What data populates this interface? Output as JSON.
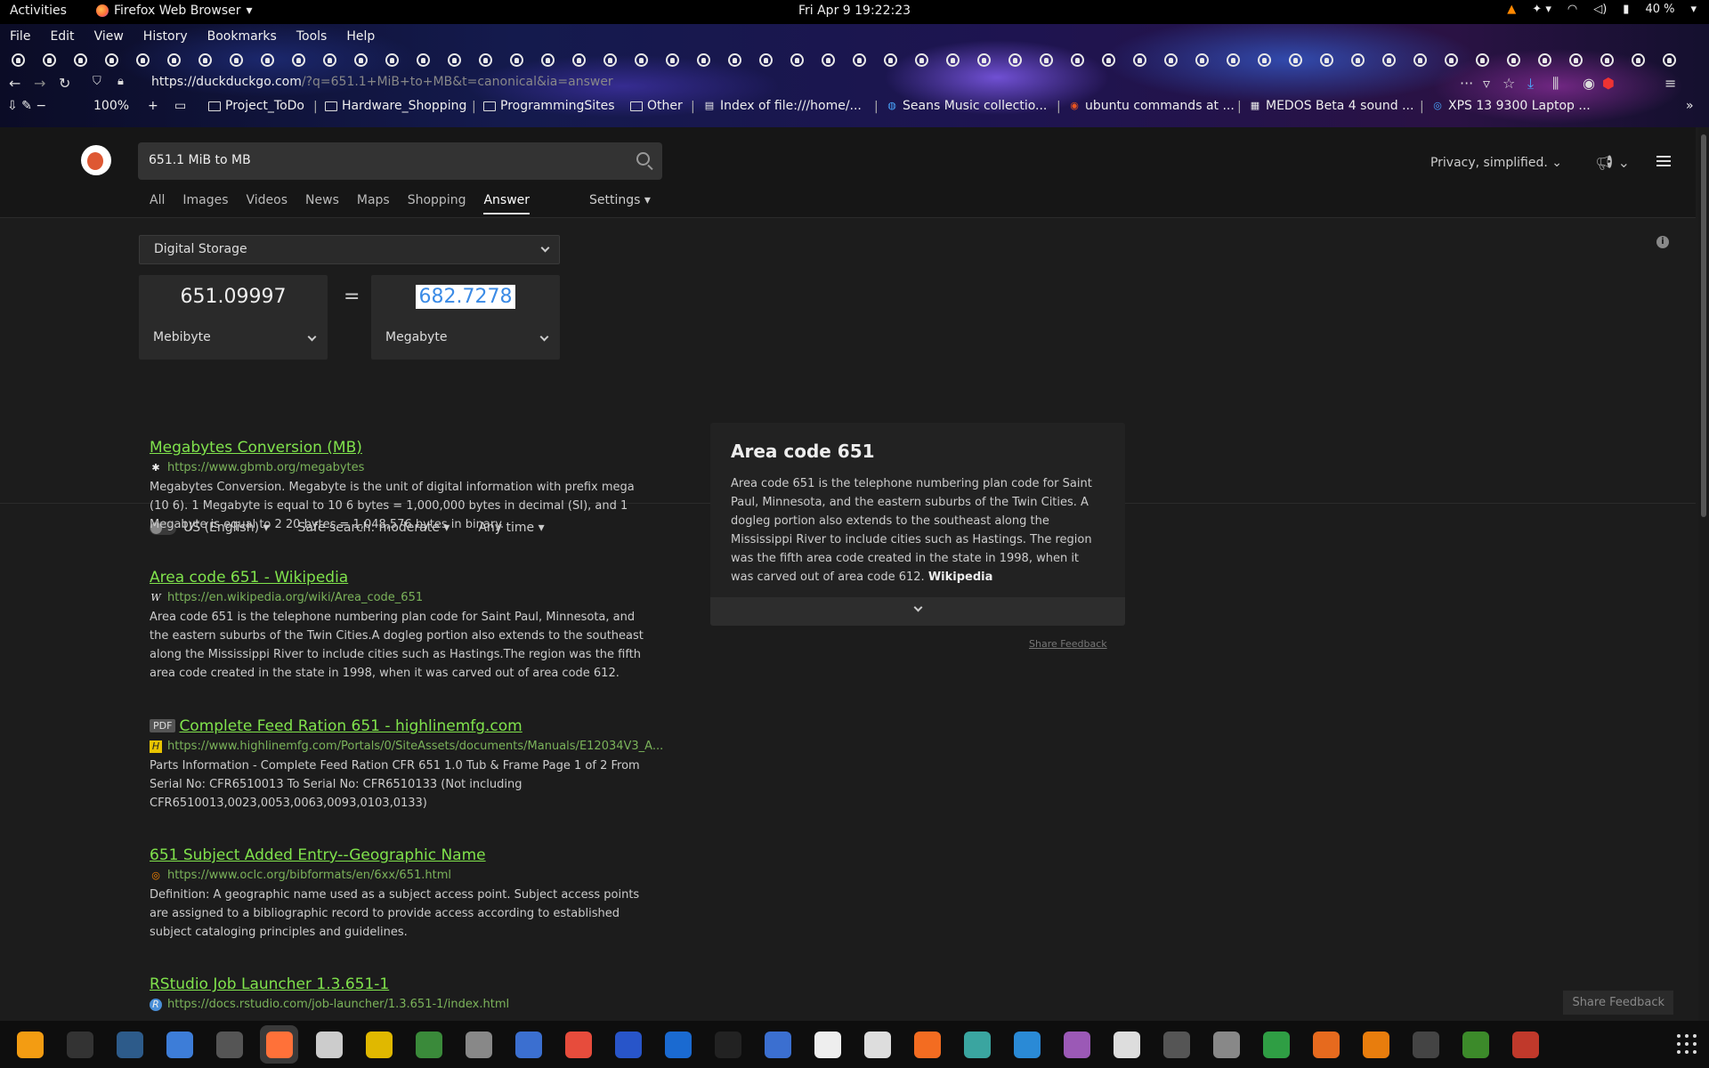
{
  "topbar": {
    "activities": "Activities",
    "app_name": "Firefox Web Browser",
    "clock": "Fri Apr 9  19:22:23",
    "battery": "40 %"
  },
  "menubar": [
    "File",
    "Edit",
    "View",
    "History",
    "Bookmarks",
    "Tools",
    "Help"
  ],
  "navbar": {
    "url_host": "https://duckduckgo.com",
    "url_rest": "/?q=651.1+MiB+to+MB&t=canonical&ia=answer",
    "zoom": "100%"
  },
  "bookmarks": [
    {
      "label": "Project_ToDo",
      "type": "folder"
    },
    {
      "label": "Hardware_Shopping",
      "type": "folder"
    },
    {
      "label": "ProgrammingSites",
      "type": "folder"
    },
    {
      "label": "Other",
      "type": "folder"
    },
    {
      "label": "Index of file:///home/...",
      "type": "page"
    },
    {
      "label": "Seans Music collectio...",
      "type": "page"
    },
    {
      "label": "ubuntu commands at ...",
      "type": "page"
    },
    {
      "label": "MEDOS Beta 4 sound ...",
      "type": "page"
    },
    {
      "label": "XPS 13 9300 Laptop ...",
      "type": "page"
    }
  ],
  "search": {
    "query": "651.1 MiB to MB",
    "privacy_label": "Privacy, simplified.",
    "tabs": [
      "All",
      "Images",
      "Videos",
      "News",
      "Maps",
      "Shopping",
      "Answer"
    ],
    "active_tab": "Answer",
    "settings_label": "Settings"
  },
  "converter": {
    "category": "Digital Storage",
    "from_value": "651.09997",
    "from_unit": "Mebibyte",
    "equals": "=",
    "to_value": "682.7278",
    "to_unit": "Megabyte"
  },
  "filters": {
    "region": "US (English)",
    "safe_search": "Safe search: moderate",
    "time": "Any time"
  },
  "results": [
    {
      "title": "Megabytes Conversion (MB)",
      "url": "https://www.gbmb.org/megabytes",
      "snippet": "Megabytes Conversion. Megabyte is the unit of digital information with prefix mega (10 6). 1 Megabyte is equal to 10 6 bytes = 1,000,000 bytes in decimal (SI), and 1 Megabyte is equal to 2 20 bytes = 1,048,576 bytes in binary."
    },
    {
      "title": "Area code 651 - Wikipedia",
      "url": "https://en.wikipedia.org/wiki/Area_code_651",
      "snippet": "Area code 651 is the telephone numbering plan code for Saint Paul, Minnesota, and the eastern suburbs of the Twin Cities.A dogleg portion also extends to the southeast along the Mississippi River to include cities such as Hastings.The region was the fifth area code created in the state in 1998, when it was carved out of area code 612."
    },
    {
      "badge": "PDF",
      "title": "Complete Feed Ration 651 - highlinemfg.com",
      "url": "https://www.highlinemfg.com/Portals/0/SiteAssets/documents/Manuals/E12034V3_A...",
      "snippet": "Parts Information - Complete Feed Ration CFR 651 1.0 Tub & Frame Page 1 of 2 From Serial No: CFR6510013 To Serial No: CFR6510133 (Not including CFR6510013,0023,0053,0063,0093,0103,0133)"
    },
    {
      "title": "651 Subject Added Entry--Geographic Name",
      "url": "https://www.oclc.org/bibformats/en/6xx/651.html",
      "snippet": "Definition: A geographic name used as a subject access point. Subject access points are assigned to a bibliographic record to provide access according to established subject cataloging principles and guidelines."
    },
    {
      "title": "RStudio Job Launcher 1.3.651-1",
      "url": "https://docs.rstudio.com/job-launcher/1.3.651-1/index.html",
      "snippet": ""
    }
  ],
  "panel": {
    "title": "Area code 651",
    "body": "Area code 651 is the telephone numbering plan code for Saint Paul, Minnesota, and the eastern suburbs of the Twin Cities. A dogleg portion also extends to the southeast along the Mississippi River to include cities such as Hastings. The region was the fifth area code created in the state in 1998, when it was carved out of area code 612.",
    "source": "Wikipedia",
    "share_feedback": "Share Feedback"
  },
  "share_feedback_button": "Share Feedback",
  "dock": [
    "vlc-icon",
    "terminal-icon",
    "system-monitor-icon",
    "text-editor-icon",
    "clock-icon",
    "firefox-icon",
    "files-icon",
    "calculator-icon",
    "tweaks-icon",
    "settings-icon",
    "document-viewer-icon",
    "system-graph-icon",
    "audio-icon",
    "virtualbox-icon",
    "inkscape-icon",
    "screenshot-icon",
    "typora-icon",
    "character-map-icon",
    "software-center-icon",
    "calendar-icon",
    "help-icon",
    "toggle-icon",
    "font-viewer-icon",
    "arch-icon",
    "disk-usage-icon",
    "spreadsheet-icon",
    "presentation-icon",
    "blender-icon",
    "nomacs-icon",
    "minecraft-icon",
    "game-icon"
  ],
  "colors": {
    "link": "#80e34c",
    "url": "#7bb35a",
    "highlight_text": "#3b8be6"
  }
}
